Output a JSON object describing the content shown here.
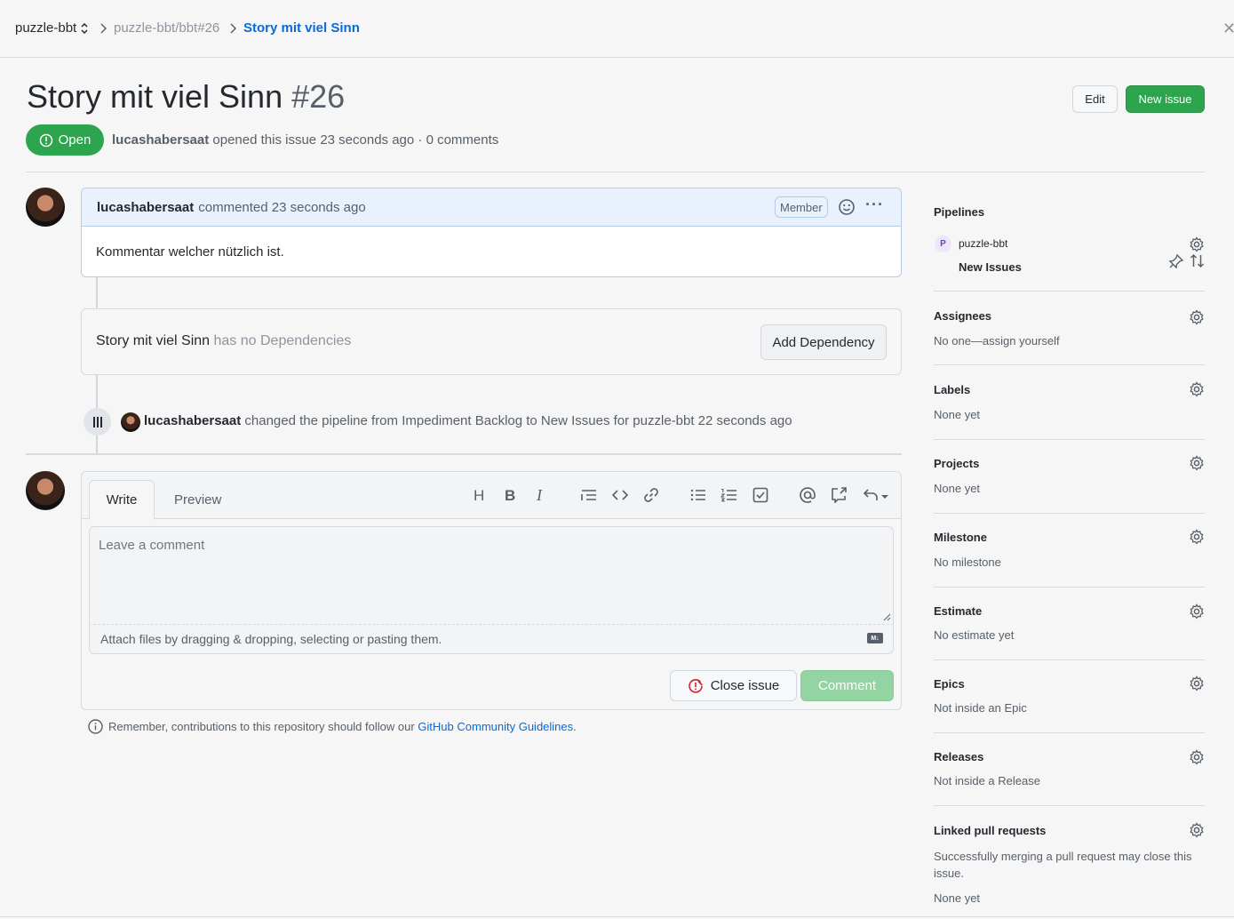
{
  "breadcrumb": {
    "repo": "puzzle-bbt",
    "issue_ref": "puzzle-bbt/bbt#26",
    "current": "Story mit viel Sinn"
  },
  "header": {
    "title": "Story mit viel Sinn",
    "number": "#26",
    "edit_label": "Edit",
    "new_issue_label": "New issue",
    "state": "Open",
    "author": "lucashabersaat",
    "opened_text": "opened this issue 23 seconds ago",
    "comments_text": "· 0 comments"
  },
  "comment": {
    "author": "lucashabersaat",
    "time": "commented 23 seconds ago",
    "role": "Member",
    "body": "Kommentar welcher nützlich ist."
  },
  "dependencies": {
    "title": "Story mit viel Sinn",
    "status": "has no Dependencies",
    "button": "Add Dependency"
  },
  "event": {
    "author": "lucashabersaat",
    "text": "changed the pipeline from Impediment Backlog to New Issues for puzzle-bbt 22 seconds ago"
  },
  "editor": {
    "tab_write": "Write",
    "tab_preview": "Preview",
    "placeholder": "Leave a comment",
    "attach_text": "Attach files by dragging & dropping, selecting or pasting them.",
    "markdown_badge": "M↓",
    "close_issue_label": "Close issue",
    "comment_label": "Comment",
    "toolbar_icons": [
      "heading-icon",
      "bold-icon",
      "italic-icon",
      "quote-icon",
      "code-icon",
      "link-icon",
      "bullet-list-icon",
      "numbered-list-icon",
      "task-list-icon",
      "mention-icon",
      "reference-icon",
      "reply-icon"
    ]
  },
  "guidelines": {
    "prefix": "Remember, contributions to this repository should follow our",
    "link": "GitHub Community Guidelines",
    "suffix": "."
  },
  "sidebar": {
    "pipelines": {
      "title": "Pipelines",
      "badge": "P",
      "repo": "puzzle-bbt",
      "stage": "New Issues"
    },
    "assignees": {
      "title": "Assignees",
      "value": "No one—assign yourself"
    },
    "labels": {
      "title": "Labels",
      "value": "None yet"
    },
    "projects": {
      "title": "Projects",
      "value": "None yet"
    },
    "milestone": {
      "title": "Milestone",
      "value": "No milestone"
    },
    "estimate": {
      "title": "Estimate",
      "value": "No estimate yet"
    },
    "epics": {
      "title": "Epics",
      "value": "Not inside an Epic"
    },
    "releases": {
      "title": "Releases",
      "value": "Not inside a Release"
    },
    "linked_prs": {
      "title": "Linked pull requests",
      "description": "Successfully merging a pull request may close this issue.",
      "value": "None yet"
    }
  },
  "colors": {
    "accent_green": "#2da44e",
    "link_blue": "#0969da",
    "comment_header": "#e9f1fc"
  }
}
